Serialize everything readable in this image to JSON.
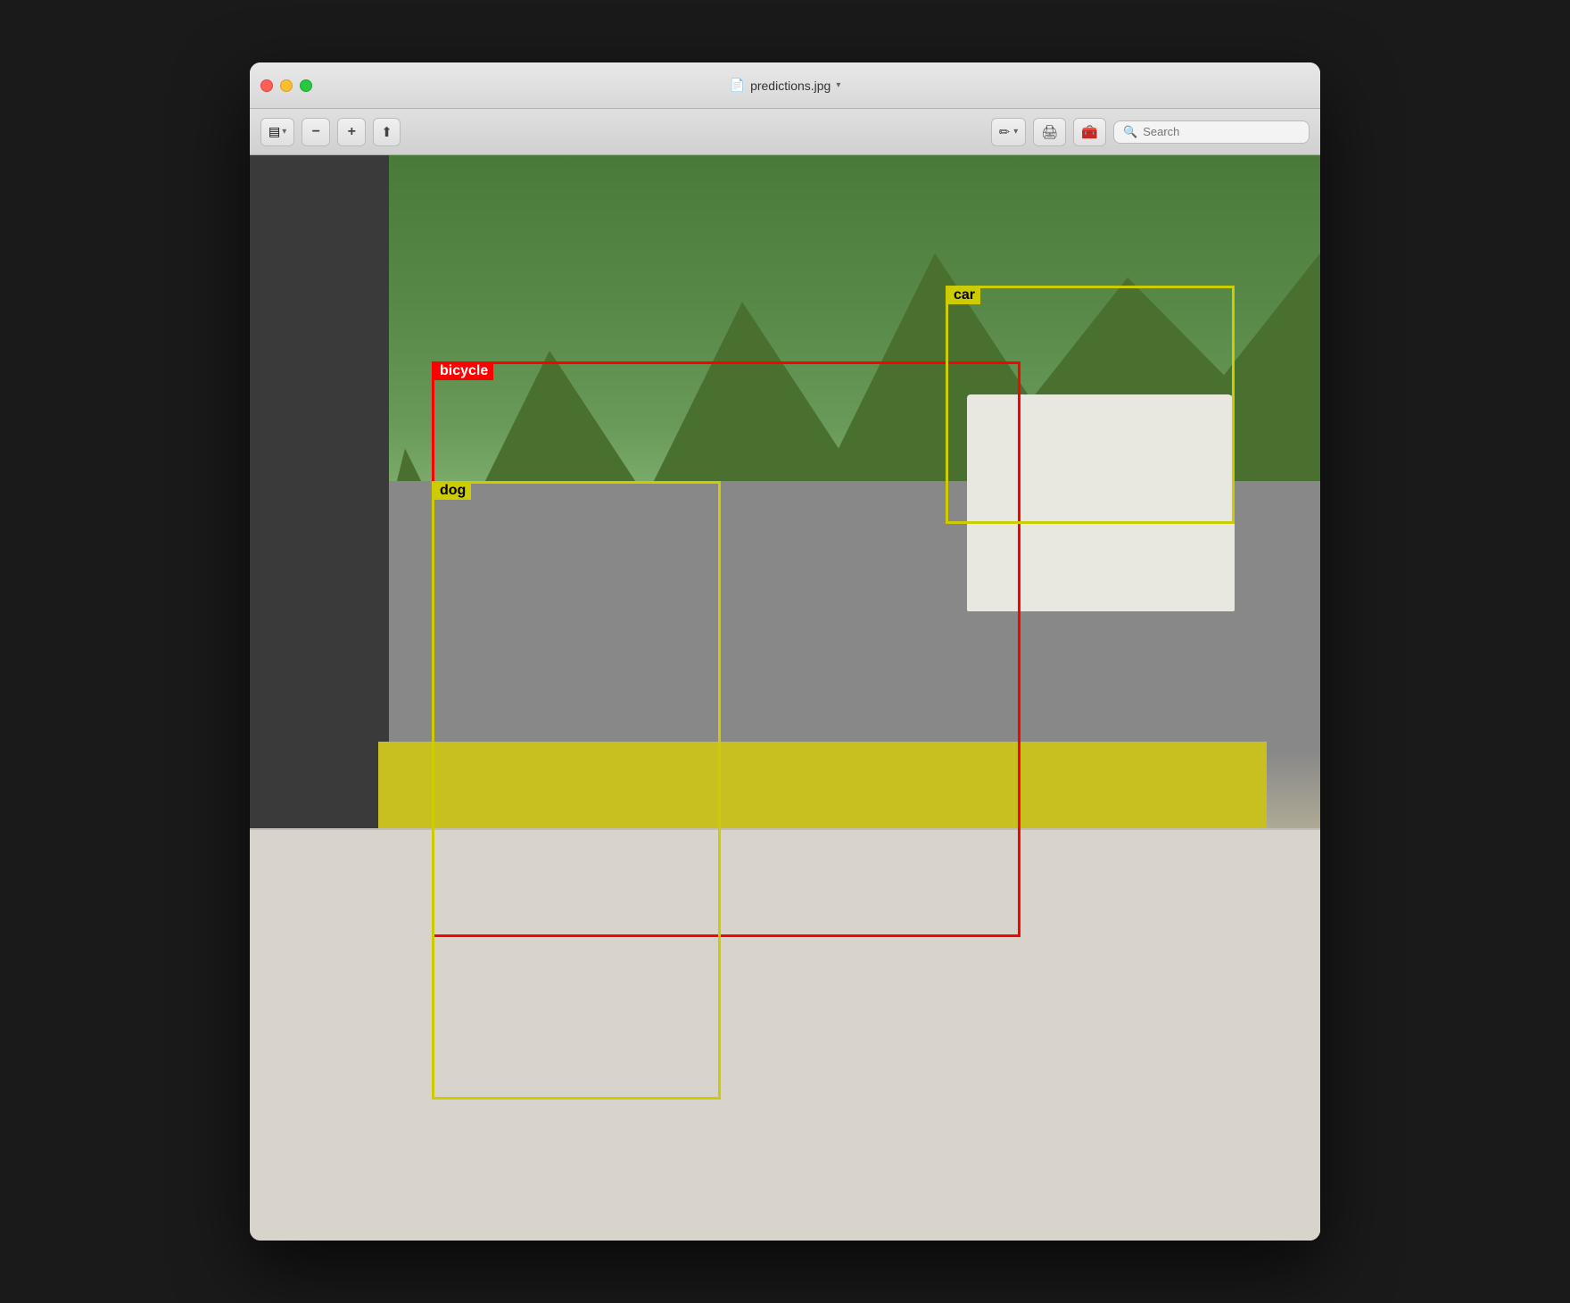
{
  "window": {
    "title": "predictions.jpg",
    "title_icon": "📄"
  },
  "toolbar": {
    "sidebar_toggle_icon": "⊞",
    "zoom_out_icon": "−",
    "zoom_in_icon": "+",
    "share_icon": "↑",
    "markup_icon": "✏",
    "dropdown_icon": "▾",
    "export_icon": "🖨",
    "toolbox_icon": "🧰",
    "search_placeholder": "Search"
  },
  "detections": [
    {
      "id": "bicycle",
      "label": "bicycle",
      "color": "red",
      "label_bg": "red-bg",
      "box_class": "bicycle-box"
    },
    {
      "id": "dog",
      "label": "dog",
      "color": "yellow",
      "label_bg": "yellow-bg",
      "box_class": "dog-box"
    },
    {
      "id": "car",
      "label": "car",
      "color": "yellow",
      "label_bg": "yellow-bg",
      "box_class": "car-box"
    }
  ]
}
